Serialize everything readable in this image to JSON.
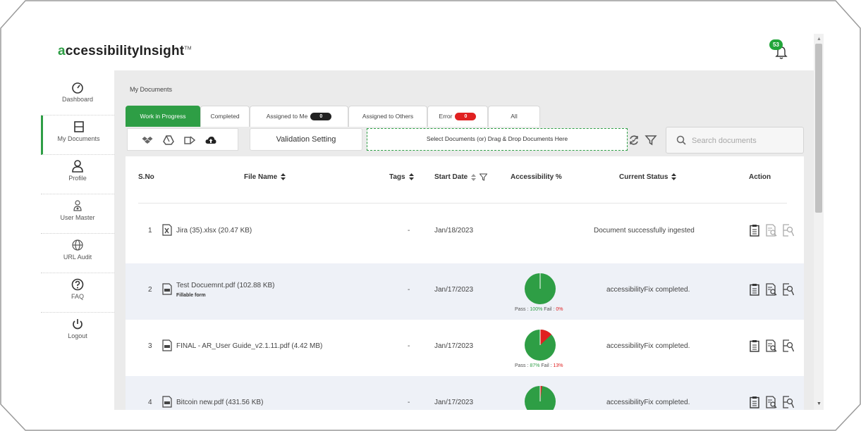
{
  "app": {
    "logo_first": "a",
    "logo_rest": "ccessibilityInsight",
    "logo_tm": "TM",
    "notification_count": "53"
  },
  "sidebar": {
    "items": [
      {
        "label": "Dashboard",
        "icon": "gauge-icon"
      },
      {
        "label": "My Documents",
        "icon": "folder-icon",
        "active": true
      },
      {
        "label": "Profile",
        "icon": "user-icon"
      },
      {
        "label": "User Master",
        "icon": "user-settings-icon"
      },
      {
        "label": "URL Audit",
        "icon": "globe-icon"
      },
      {
        "label": "FAQ",
        "icon": "question-icon"
      },
      {
        "label": "Logout",
        "icon": "power-icon"
      }
    ]
  },
  "breadcrumb": "My Documents",
  "tabs": [
    {
      "label": "Work in Progress",
      "active": true
    },
    {
      "label": "Completed"
    },
    {
      "label": "Assigned to Me",
      "badge": "0"
    },
    {
      "label": "Assigned to Others"
    },
    {
      "label": "Error",
      "badge": "0"
    },
    {
      "label": "All"
    }
  ],
  "toolbar": {
    "validation_label": "Validation Setting",
    "drop_zone_label": "Select Documents (or) Drag & Drop Documents Here",
    "search_placeholder": "Search documents"
  },
  "table": {
    "headers": {
      "sno": "S.No",
      "file_name": "File Name",
      "tags": "Tags",
      "start_date": "Start Date",
      "accessibility": "Accessibility %",
      "status": "Current Status",
      "action": "Action"
    },
    "rows": [
      {
        "sno": "1",
        "file": "Jira (35).xlsx (20.47 KB)",
        "type": "xlsx",
        "sub": "",
        "tags": "-",
        "date": "Jan/18/2023",
        "pass": null,
        "fail": null,
        "pass_label": "",
        "fail_label": "",
        "status": "Document successfully ingested"
      },
      {
        "sno": "2",
        "file": "Test Docuemnt.pdf (102.88 KB)",
        "type": "pdf",
        "sub": "Fillable form",
        "tags": "-",
        "date": "Jan/17/2023",
        "pass": 100,
        "fail": 0,
        "pass_label": "100%",
        "fail_label": "0%",
        "status": "accessibilityFix completed."
      },
      {
        "sno": "3",
        "file": "FINAL - AR_User Guide_v2.1.11.pdf (4.42 MB)",
        "type": "pdf",
        "sub": "",
        "tags": "-",
        "date": "Jan/17/2023",
        "pass": 87,
        "fail": 13,
        "pass_label": "87%",
        "fail_label": "13%",
        "status": "accessibilityFix completed."
      },
      {
        "sno": "4",
        "file": "Bitcoin new.pdf (431.56 KB)",
        "type": "pdf",
        "sub": "",
        "tags": "-",
        "date": "Jan/17/2023",
        "pass": 98,
        "fail": 2,
        "pass_label": "98%",
        "fail_label": "2%",
        "status": "accessibilityFix completed."
      }
    ],
    "pass_prefix": "Pass : ",
    "fail_prefix": " Fail : "
  },
  "colors": {
    "accent": "#2e9e45",
    "pass": "#2e9e45",
    "fail": "#e02020"
  }
}
